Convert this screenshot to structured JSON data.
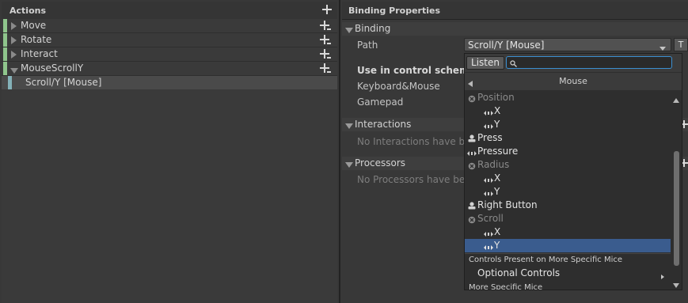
{
  "left_panel": {
    "title": "Actions",
    "actions": [
      {
        "label": "Move",
        "expanded": false
      },
      {
        "label": "Rotate",
        "expanded": false
      },
      {
        "label": "Interact",
        "expanded": false
      },
      {
        "label": "MouseScrollY",
        "expanded": true
      }
    ],
    "bindings": [
      {
        "label": "Scroll/Y [Mouse]",
        "selected": true
      }
    ]
  },
  "right_panel": {
    "title": "Binding Properties",
    "binding_section": "Binding",
    "path_label": "Path",
    "path_value": "Scroll/Y [Mouse]",
    "t_button": "T",
    "use_in_scheme": "Use in control scheme",
    "schemes": [
      "Keyboard&Mouse",
      "Gamepad"
    ],
    "interactions_section": "Interactions",
    "interactions_empty": "No Interactions have bee",
    "processors_section": "Processors",
    "processors_empty": "No Processors have bee"
  },
  "popup": {
    "listen_label": "Listen",
    "search_value": "",
    "nav_title": "Mouse",
    "items": [
      {
        "label": "Position",
        "icon": "vector-icon",
        "indent": 0,
        "disabled": true
      },
      {
        "label": "X",
        "icon": "axis-icon",
        "indent": 1
      },
      {
        "label": "Y",
        "icon": "axis-icon",
        "indent": 1
      },
      {
        "label": "Press",
        "icon": "button-icon",
        "indent": 0
      },
      {
        "label": "Pressure",
        "icon": "axis-icon",
        "indent": 0
      },
      {
        "label": "Radius",
        "icon": "vector-icon",
        "indent": 0,
        "disabled": true
      },
      {
        "label": "X",
        "icon": "axis-icon",
        "indent": 1
      },
      {
        "label": "Y",
        "icon": "axis-icon",
        "indent": 1
      },
      {
        "label": "Right Button",
        "icon": "button-icon",
        "indent": 0
      },
      {
        "label": "Scroll",
        "icon": "vector-icon",
        "indent": 0,
        "disabled": true
      },
      {
        "label": "X",
        "icon": "axis-icon",
        "indent": 1
      },
      {
        "label": "Y",
        "icon": "axis-icon",
        "indent": 1,
        "selected": true
      }
    ],
    "section_present": "Controls Present on More Specific Mice",
    "optional_controls": "Optional Controls",
    "more_specific": "More Specific Mice"
  },
  "colors": {
    "action_bar": "#8fc58c",
    "binding_bar": "#84b1b8",
    "selection": "#3a5c8e",
    "search_focus": "#3b8fd1"
  }
}
